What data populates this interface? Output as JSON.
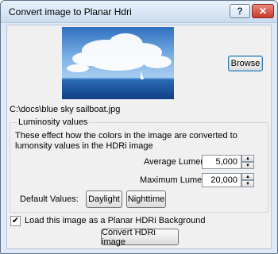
{
  "window": {
    "title": "Convert image to Planar Hdri",
    "help_glyph": "?",
    "close_glyph": "✕"
  },
  "image": {
    "file_path": "C:\\docs\\blue sky sailboat.jpg",
    "browse_label": "Browse"
  },
  "luminosity": {
    "group_label": "Luminosity values",
    "description": "These effect how the colors in the image are converted to lumonsity values in the HDRi image",
    "average_label": "Average Lumens",
    "average_value": "5,000",
    "maximum_label": "Maximum Lumens",
    "maximum_value": "20,000",
    "defaults_label": "Default Values:",
    "daylight_label": "Daylight",
    "nighttime_label": "Nighttime"
  },
  "background_option": {
    "label": "Load this image as a Planar HDRi Background",
    "checked": true
  },
  "convert_label": "Convert HDRi image",
  "colors": {
    "title_bg": "#d6e5f5",
    "dialog_bg": "#f0f0f0",
    "close_red": "#c8392a",
    "sky_blue": "#4f8fd3"
  }
}
